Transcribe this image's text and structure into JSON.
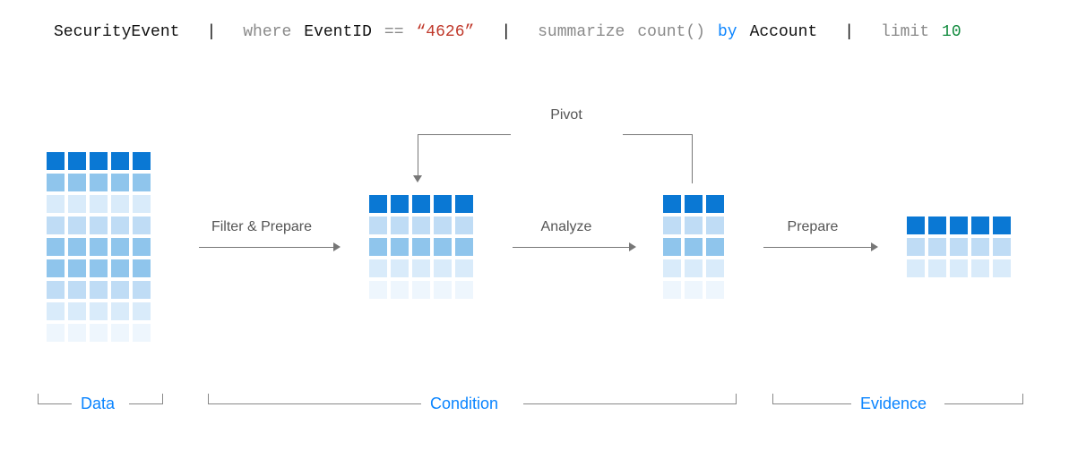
{
  "query": {
    "tokens": [
      {
        "text": "SecurityEvent",
        "cls": "tok-black"
      },
      {
        "text": "where",
        "cls": "tok-gray"
      },
      {
        "text": "EventID",
        "cls": "tok-black"
      },
      {
        "text": "==",
        "cls": "tok-gray"
      },
      {
        "text": "“4626”",
        "cls": "tok-red"
      },
      {
        "text": "summarize",
        "cls": "tok-gray"
      },
      {
        "text": "count()",
        "cls": "tok-gray"
      },
      {
        "text": "by",
        "cls": "tok-blue"
      },
      {
        "text": "Account",
        "cls": "tok-black"
      },
      {
        "text": "limit",
        "cls": "tok-gray"
      },
      {
        "text": "10",
        "cls": "tok-green"
      }
    ],
    "pipe_after": [
      0,
      4,
      8
    ]
  },
  "flows": {
    "filter_prepare": "Filter & Prepare",
    "analyze": "Analyze",
    "prepare": "Prepare",
    "pivot": "Pivot"
  },
  "sections": {
    "data": "Data",
    "condition": "Condition",
    "evidence": "Evidence"
  },
  "colors": {
    "dark": "#0a78d4",
    "mid": "#8fc5ec",
    "light": "#bfdcf5",
    "lighter": "#d9ebfa",
    "palest": "#eef6fd"
  },
  "grids": {
    "data": {
      "rows": 9,
      "cols": 5,
      "row_shades": [
        "dark",
        "mid",
        "lighter",
        "light",
        "mid",
        "mid",
        "light",
        "lighter",
        "palest"
      ]
    },
    "cond1": {
      "rows": 5,
      "cols": 5,
      "row_shades": [
        "dark",
        "light",
        "mid",
        "lighter",
        "palest"
      ]
    },
    "cond2": {
      "rows": 5,
      "cols": 3,
      "row_shades": [
        "dark",
        "light",
        "mid",
        "lighter",
        "palest"
      ]
    },
    "evidence": {
      "rows": 3,
      "cols": 5,
      "row_shades": [
        "dark",
        "light",
        "lighter"
      ]
    }
  }
}
